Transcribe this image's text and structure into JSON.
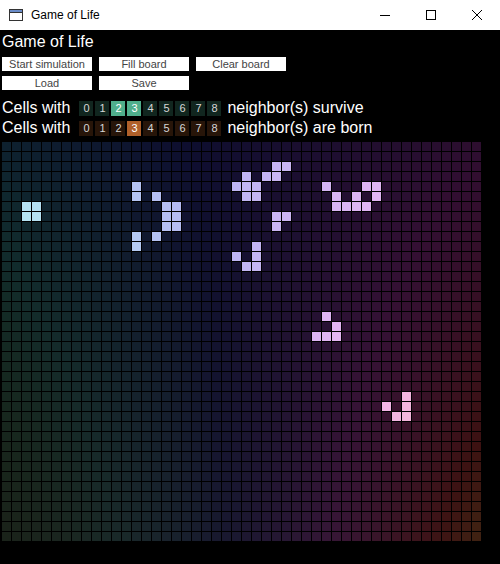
{
  "window": {
    "title": "Game of Life"
  },
  "heading": "Game of Life",
  "toolbar": {
    "rows": [
      {
        "buttons": [
          {
            "label": "Start simulation"
          },
          {
            "label": "Fill board"
          },
          {
            "label": "Clear board"
          }
        ]
      },
      {
        "buttons": [
          {
            "label": "Load"
          },
          {
            "label": "Save"
          }
        ]
      }
    ]
  },
  "rules": [
    {
      "kind": "survive",
      "prefix": "Cells with",
      "suffix": "neighbor(s) survive",
      "color": "#4fae8c",
      "options": [
        {
          "label": "0",
          "selected": false
        },
        {
          "label": "1",
          "selected": false
        },
        {
          "label": "2",
          "selected": true
        },
        {
          "label": "3",
          "selected": true
        },
        {
          "label": "4",
          "selected": false
        },
        {
          "label": "5",
          "selected": false
        },
        {
          "label": "6",
          "selected": false
        },
        {
          "label": "7",
          "selected": false
        },
        {
          "label": "8",
          "selected": false
        }
      ]
    },
    {
      "kind": "born",
      "prefix": "Cells with",
      "suffix": "neighbor(s) are born",
      "color": "#b0602a",
      "options": [
        {
          "label": "0",
          "selected": false
        },
        {
          "label": "1",
          "selected": false
        },
        {
          "label": "2",
          "selected": false
        },
        {
          "label": "3",
          "selected": true
        },
        {
          "label": "4",
          "selected": false
        },
        {
          "label": "5",
          "selected": false
        },
        {
          "label": "6",
          "selected": false
        },
        {
          "label": "7",
          "selected": false
        },
        {
          "label": "8",
          "selected": false
        }
      ]
    }
  ],
  "board": {
    "rows": [
      "................................................",
      "................................................",
      "...........................##...................",
      "........................#.##....................",
      ".............#.........###......#...##..........",
      ".............#.#........##.......#.#.#..........",
      "..##............##...............####...........",
      "..##............##.........##...................",
      "................##.........#....................",
      ".............#.#................................",
      ".............#...........#......................",
      ".......................#.#......................",
      "........................##......................",
      "................................................",
      "................................................",
      "................................................",
      "................................................",
      "................................#...............",
      ".................................#..............",
      "...............................###..............",
      "................................................",
      "................................................",
      "................................................",
      "................................................",
      "................................................",
      "........................................#.......",
      "......................................#.#.......",
      ".......................................##.......",
      "................................................",
      "................................................",
      "................................................",
      "................................................",
      "................................................",
      "................................................",
      "................................................",
      "................................................",
      "................................................",
      "................................................",
      "................................................",
      "................................................"
    ]
  }
}
